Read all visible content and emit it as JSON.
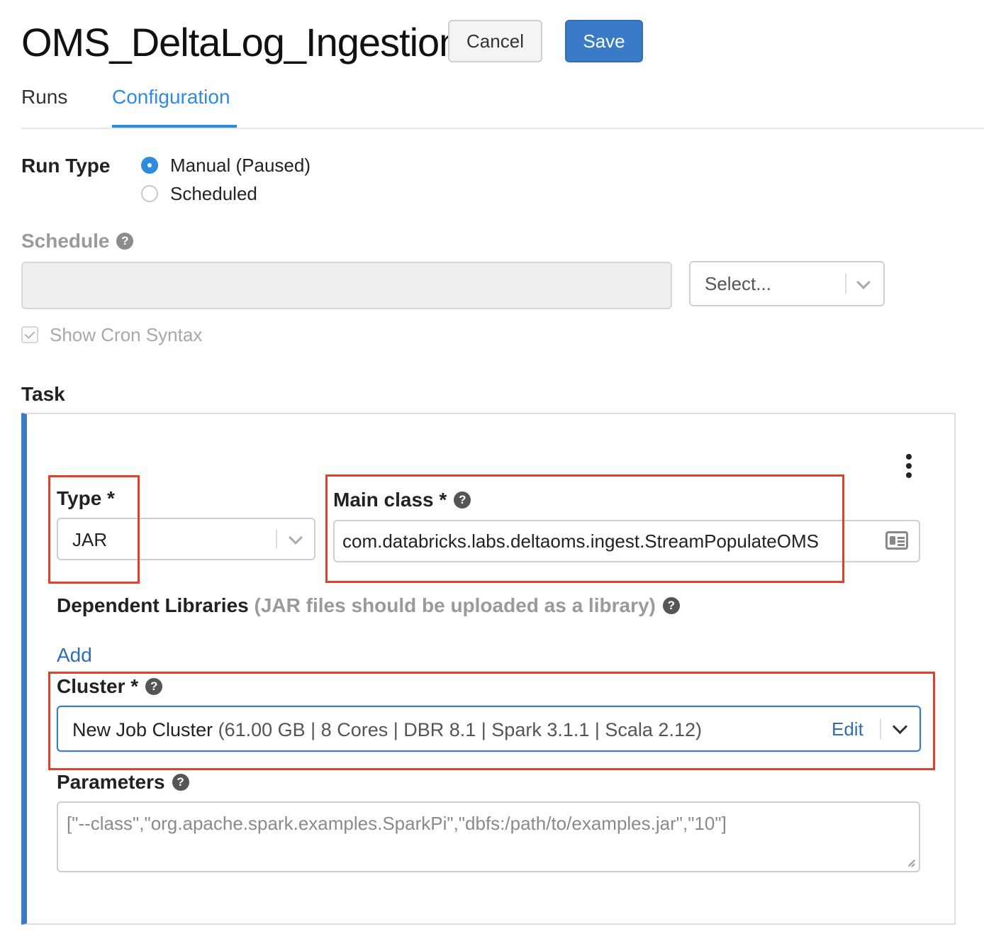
{
  "header": {
    "title": "OMS_DeltaLog_Ingestion",
    "cancel_label": "Cancel",
    "save_label": "Save"
  },
  "tabs": [
    {
      "label": "Runs",
      "active": false
    },
    {
      "label": "Configuration",
      "active": true
    }
  ],
  "run_type": {
    "label": "Run Type",
    "options": [
      {
        "label": "Manual (Paused)",
        "selected": true
      },
      {
        "label": "Scheduled",
        "selected": false
      }
    ]
  },
  "schedule": {
    "label": "Schedule",
    "help_glyph": "?",
    "cron_value": "",
    "select_placeholder": "Select...",
    "show_cron_label": "Show Cron Syntax",
    "show_cron_checked": true
  },
  "task": {
    "label": "Task",
    "type_label": "Type *",
    "type_value": "JAR",
    "main_class_label": "Main class *",
    "main_class_value": "com.databricks.labs.deltaoms.ingest.StreamPopulateOMS",
    "dependent_libraries_label": "Dependent Libraries",
    "dependent_libraries_note": "(JAR files should be uploaded as a library)",
    "add_label": "Add",
    "cluster_label": "Cluster *",
    "cluster_name": "New Job Cluster",
    "cluster_details": "(61.00 GB | 8 Cores | DBR 8.1 | Spark 3.1.1 | Scala 2.12)",
    "cluster_edit_label": "Edit",
    "parameters_label": "Parameters",
    "parameters_placeholder": "[\"--class\",\"org.apache.spark.examples.SparkPi\",\"dbfs:/path/to/examples.jar\",\"10\"]"
  },
  "colors": {
    "accent": "#2d8be0",
    "primary_button": "#3a7bc8",
    "highlight": "#e0412c"
  },
  "icons": {
    "help": "question-circle-icon",
    "kebab": "vertical-ellipsis-icon",
    "chevron": "chevron-down-icon",
    "card": "id-card-icon",
    "check": "checkmark-icon"
  }
}
